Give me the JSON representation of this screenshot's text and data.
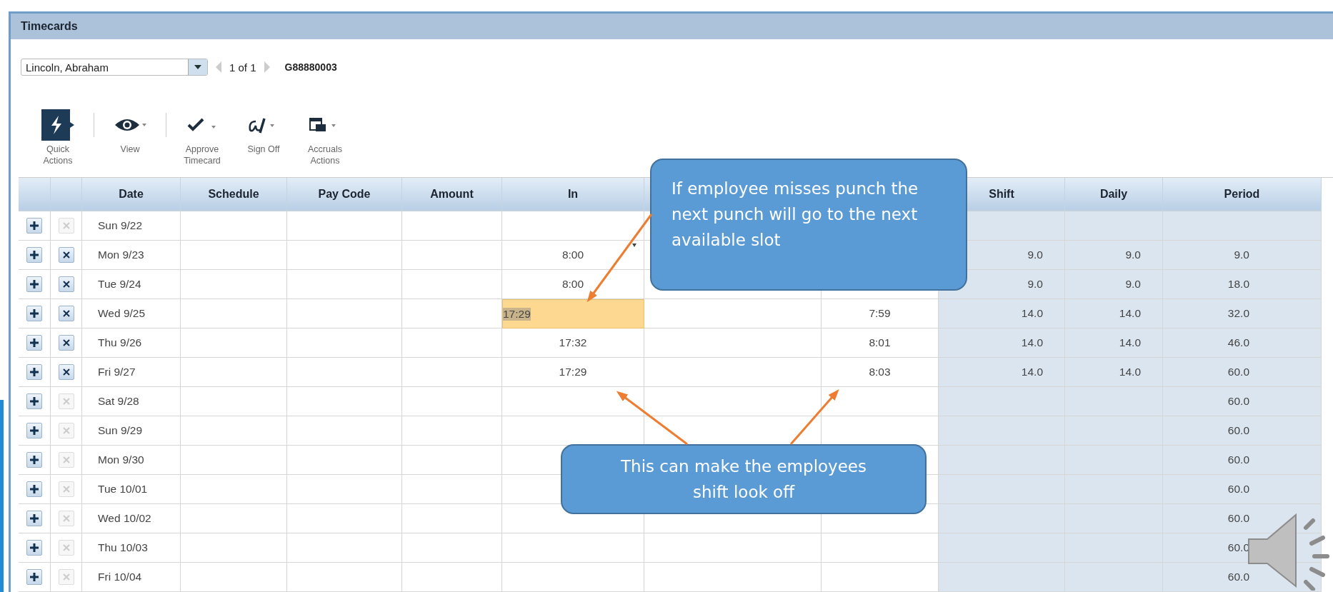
{
  "panel": {
    "title": "Timecards"
  },
  "employee_selector": {
    "value": "Lincoln, Abraham"
  },
  "pager": {
    "text": "1 of 1"
  },
  "employee_id": "G88880003",
  "toolbar": [
    {
      "kind": "quick",
      "label": "Quick Actions"
    },
    {
      "kind": "view",
      "label": "View"
    },
    {
      "kind": "approve",
      "label": "Approve Timecard"
    },
    {
      "kind": "signoff",
      "label": "Sign Off"
    },
    {
      "kind": "accruals",
      "label": "Accruals Actions"
    }
  ],
  "table": {
    "columns": [
      {
        "label": "Date"
      },
      {
        "label": "Schedule"
      },
      {
        "label": "Pay Code"
      },
      {
        "label": "Amount"
      },
      {
        "label": "In"
      },
      {},
      {},
      {
        "label": "Shift"
      },
      {
        "label": "Daily"
      },
      {
        "label": "Period"
      }
    ],
    "rows": [
      {
        "date": "Sun 9/22",
        "removable": false
      },
      {
        "date": "Mon 9/23",
        "removable": true,
        "in": "8:00",
        "in_marked": true,
        "shift": "9.0",
        "daily": "9.0",
        "period": "9.0"
      },
      {
        "date": "Tue 9/24",
        "removable": true,
        "in": "8:00",
        "shift": "9.0",
        "daily": "9.0",
        "period": "18.0"
      },
      {
        "date": "Wed 9/25",
        "removable": true,
        "in": "17:29",
        "in_selected": true,
        "out": "7:59",
        "shift": "14.0",
        "daily": "14.0",
        "period": "32.0"
      },
      {
        "date": "Thu 9/26",
        "removable": true,
        "in": "17:32",
        "out": "8:01",
        "shift": "14.0",
        "daily": "14.0",
        "period": "46.0"
      },
      {
        "date": "Fri 9/27",
        "removable": true,
        "in": "17:29",
        "out": "8:03",
        "shift": "14.0",
        "daily": "14.0",
        "period": "60.0"
      },
      {
        "date": "Sat 9/28",
        "removable": false,
        "period": "60.0"
      },
      {
        "date": "Sun 9/29",
        "removable": false,
        "period": "60.0"
      },
      {
        "date": "Mon 9/30",
        "removable": false,
        "period": "60.0"
      },
      {
        "date": "Tue 10/01",
        "removable": false,
        "period": "60.0"
      },
      {
        "date": "Wed 10/02",
        "removable": false,
        "period": "60.0"
      },
      {
        "date": "Thu 10/03",
        "removable": false,
        "period": "60.0"
      },
      {
        "date": "Fri 10/04",
        "removable": false,
        "period": "60.0"
      }
    ]
  },
  "callouts": [
    {
      "text": "If employee misses punch the next punch will go to the next available slot"
    },
    {
      "text": "This can make the employees shift look off"
    }
  ]
}
